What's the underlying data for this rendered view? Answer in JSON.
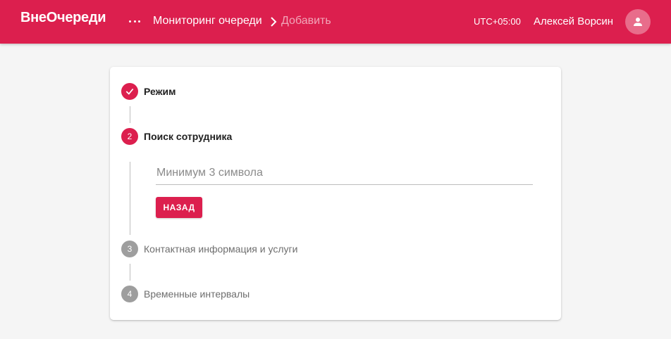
{
  "header": {
    "logo": "ВнеОчереди",
    "menu_icon": "more-horizontal-icon",
    "breadcrumb": {
      "main": "Мониторинг очереди",
      "separator_icon": "chevron-right-icon",
      "current": "Добавить"
    },
    "timezone": "UTC+05:00",
    "user_name": "Алексей Ворсин",
    "avatar_icon": "person-icon"
  },
  "stepper": {
    "steps": [
      {
        "label": "Режим",
        "status": "completed",
        "icon": "check-icon"
      },
      {
        "number": "2",
        "label": "Поиск сотрудника",
        "status": "active"
      },
      {
        "number": "3",
        "label": "Контактная информация и услуги",
        "status": "pending"
      },
      {
        "number": "4",
        "label": "Временные интервалы",
        "status": "pending"
      }
    ],
    "search": {
      "placeholder": "Минимум 3 символа",
      "value": ""
    },
    "back_button": "НАЗАД"
  },
  "colors": {
    "accent": "#dc1f4e",
    "inactive_step": "#9e9e9e",
    "background": "#f5f5f5"
  }
}
